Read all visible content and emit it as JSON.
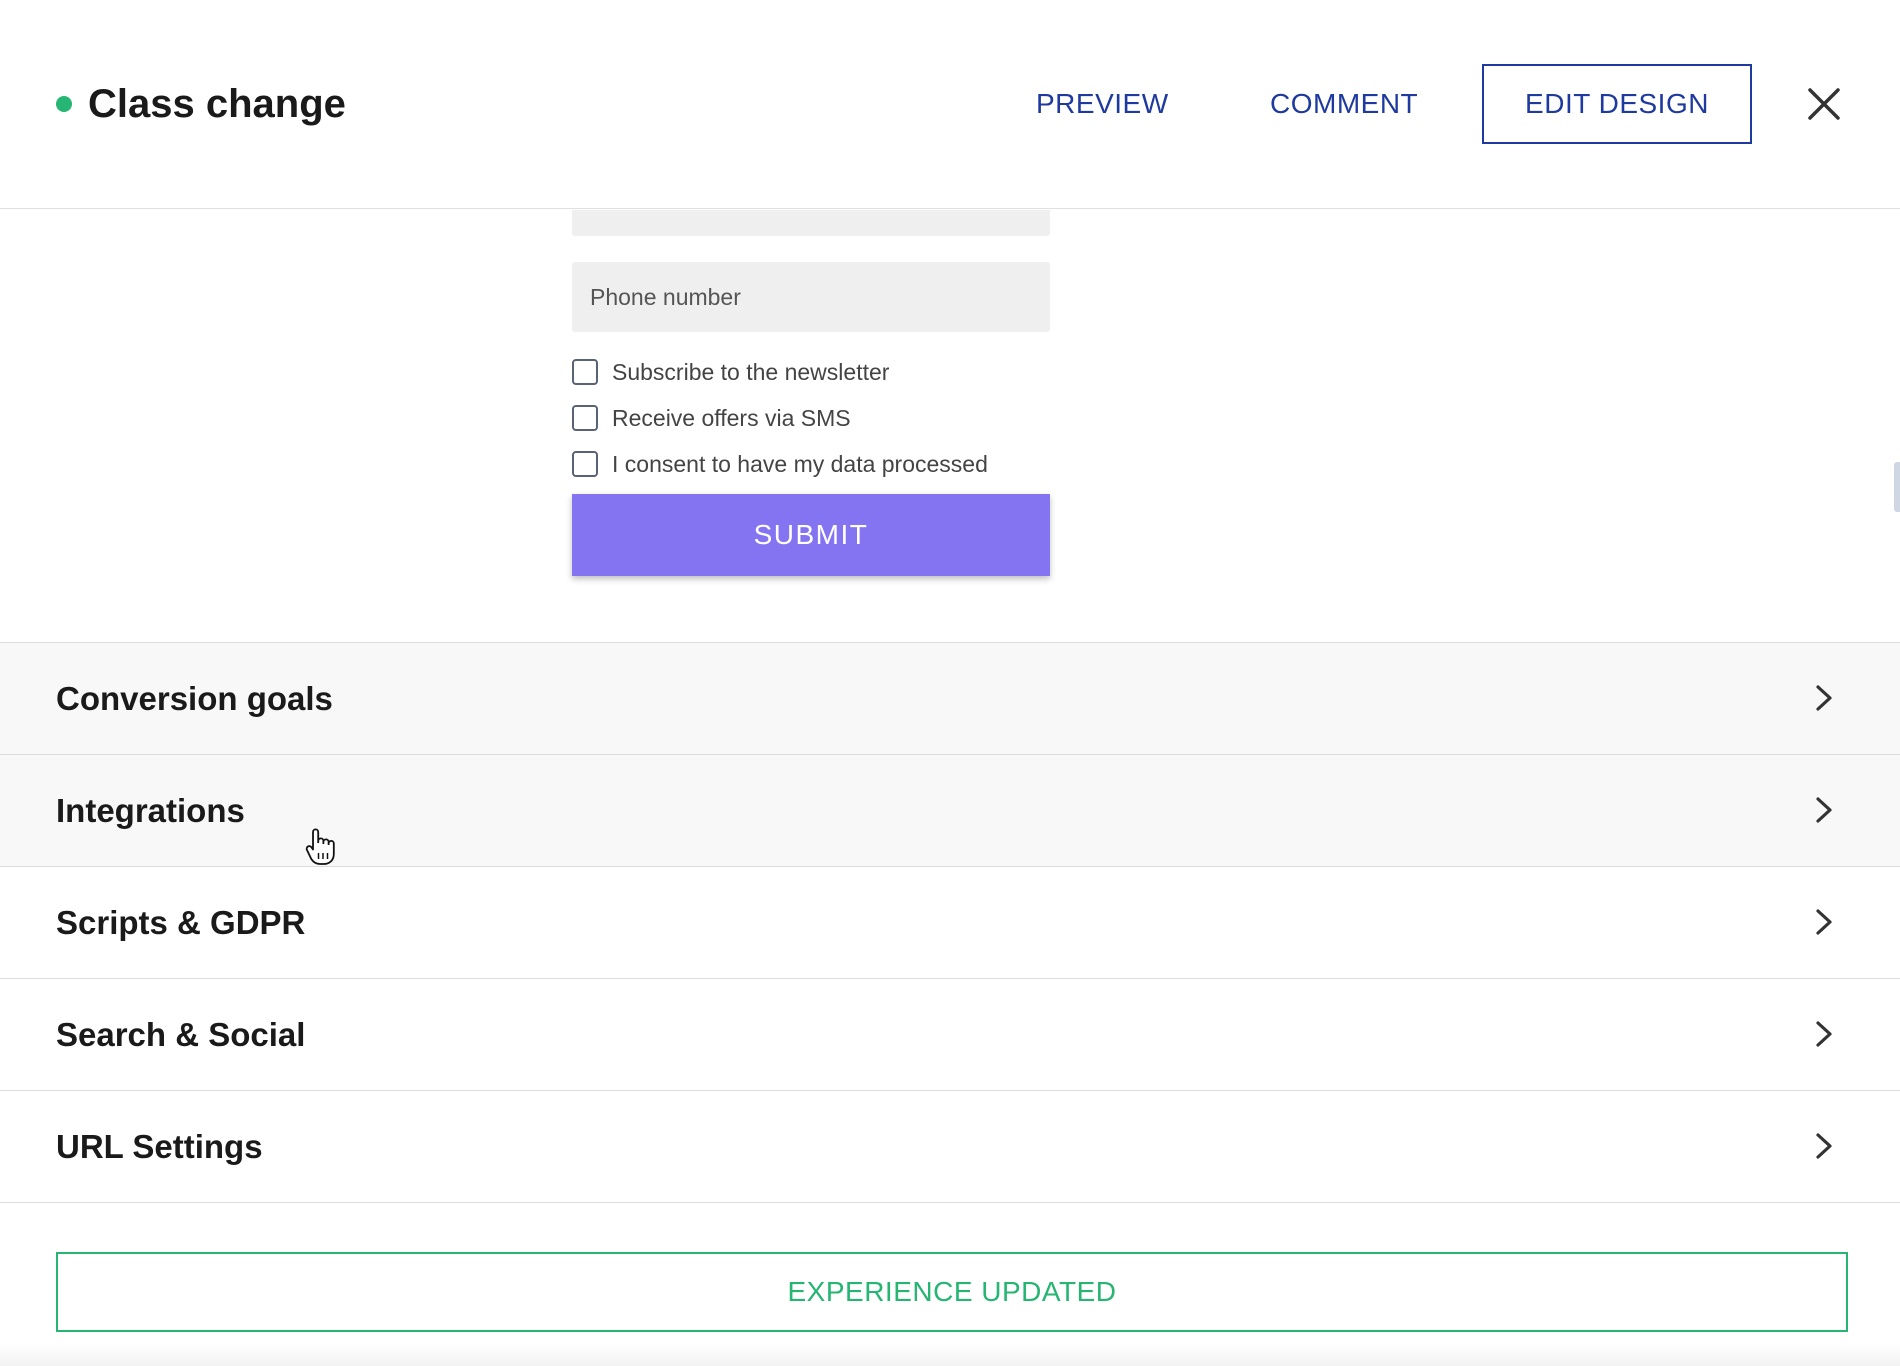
{
  "header": {
    "title": "Class change",
    "status_color": "#27b573",
    "preview_label": "PREVIEW",
    "comment_label": "COMMENT",
    "edit_design_label": "EDIT DESIGN",
    "close_icon": "close-icon",
    "accent_color": "#1f3a9e"
  },
  "form": {
    "phone_placeholder": "Phone number",
    "checkboxes": [
      {
        "label": "Subscribe to the newsletter",
        "checked": false
      },
      {
        "label": "Receive offers via SMS",
        "checked": false
      },
      {
        "label": "I consent to have my data processed",
        "checked": false
      }
    ],
    "submit_label": "SUBMIT",
    "submit_color": "#8574f1"
  },
  "sections": [
    {
      "label": "Conversion goals",
      "icon": "chevron-right-icon"
    },
    {
      "label": "Integrations",
      "icon": "chevron-right-icon"
    },
    {
      "label": "Scripts & GDPR",
      "icon": "chevron-right-icon"
    },
    {
      "label": "Search & Social",
      "icon": "chevron-right-icon"
    },
    {
      "label": "URL Settings",
      "icon": "chevron-right-icon"
    }
  ],
  "footer": {
    "status_label": "EXPERIENCE UPDATED",
    "status_color": "#27b573"
  }
}
